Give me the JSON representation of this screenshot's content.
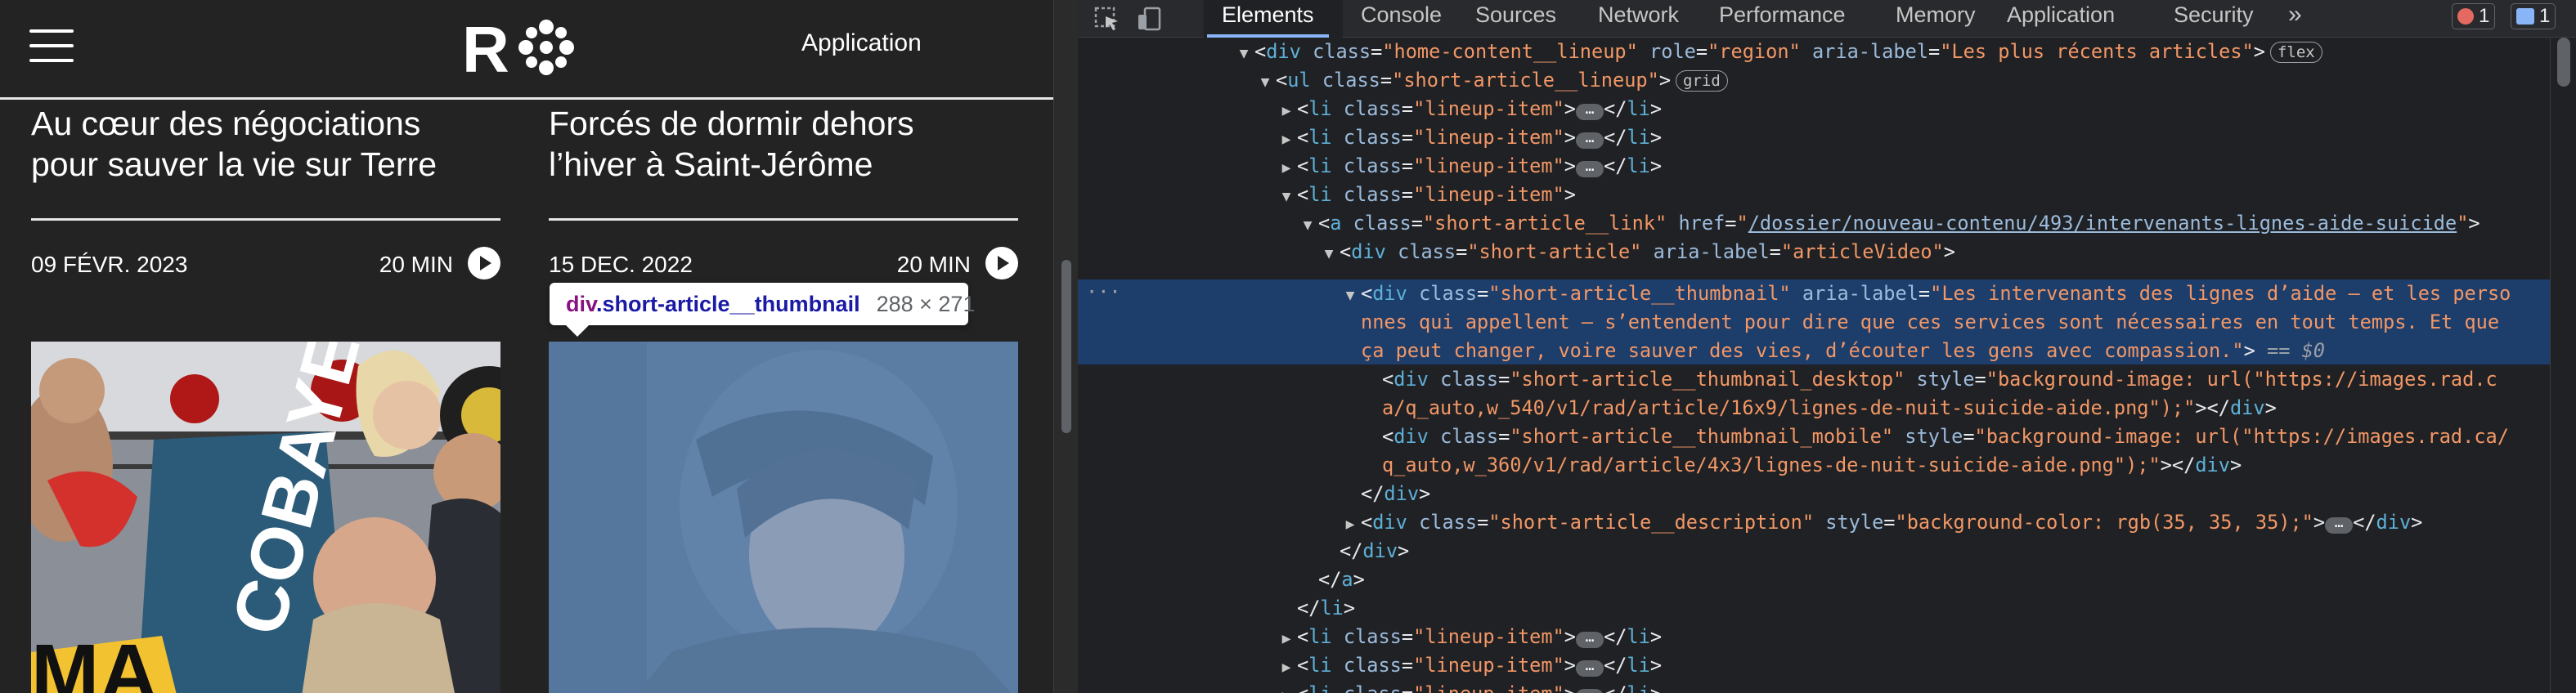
{
  "page": {
    "nav_link": "Application",
    "cards": [
      {
        "title": "Au cœur des négociations\npour sauver la vie sur Terre",
        "date": "09 FÉVR. 2023",
        "duration": "20 MIN"
      },
      {
        "title": "Forcés de dormir dehors\nl’hiver à Saint-Jérôme",
        "date": "15 DEC. 2022",
        "duration": "20 MIN"
      }
    ],
    "tooltip": {
      "tag": "div",
      "class": ".short-article__thumbnail",
      "size": "288 × 271"
    }
  },
  "devtools": {
    "tabs": [
      "Elements",
      "Console",
      "Sources",
      "Network",
      "Performance",
      "Memory",
      "Application",
      "Security"
    ],
    "more": "»",
    "error_count": "1",
    "message_count": "1",
    "tree": {
      "l0_tag": "div",
      "l0_attr1": "class",
      "l0_val1": "\"home-content__lineup\"",
      "l0_attr2": "role",
      "l0_val2": "\"region\"",
      "l0_attr3": "aria-label",
      "l0_val3": "\"Les plus récents articles\"",
      "l0_badge": "flex",
      "l1_tag": "ul",
      "l1_attr": "class",
      "l1_val": "\"short-article__lineup\"",
      "l1_badge": "grid",
      "li_tag": "li",
      "li_attr": "class",
      "li_val": "\"lineup-item\"",
      "a_tag": "a",
      "a_attr1": "class",
      "a_val1": "\"short-article__link\"",
      "a_attr2": "href",
      "a_href": "/dossier/nouveau-contenu/493/intervenants-lignes-aide-suicide",
      "sa_tag": "div",
      "sa_attr1": "class",
      "sa_val1": "\"short-article\"",
      "sa_attr2": "aria-label",
      "sa_val2": "\"articleVideo\"",
      "th_tag": "div",
      "th_attr1": "class",
      "th_val1": "\"short-article__thumbnail\"",
      "th_attr2": "aria-label",
      "th_label_1": "\"Les intervenants des lignes d’aide — et les perso",
      "th_label_2": "nnes qui appellent — s’entendent pour dire que ces services sont nécessaires en tout temps. Et que",
      "th_label_3": "ça peut changer, voire sauver des vies, d’écouter les gens avec compassion.\"",
      "th_eq": "== $0",
      "td_tag": "div",
      "td_attr1": "class",
      "td_val1": "\"short-article__thumbnail_desktop\"",
      "td_attr2": "style",
      "td_style_1": "\"background-image: url(\"https://images.rad.c",
      "td_style_2": "a/q_auto,w_540/v1/rad/article/16x9/lignes-de-nuit-suicide-aide.png\");\"",
      "tm_tag": "div",
      "tm_attr1": "class",
      "tm_val1": "\"short-article__thumbnail_mobile\"",
      "tm_attr2": "style",
      "tm_style_1": "\"background-image: url(\"https://images.rad.ca/",
      "tm_style_2": "q_auto,w_360/v1/rad/article/4x3/lignes-de-nuit-suicide-aide.png\");\"",
      "ds_tag": "div",
      "ds_attr1": "class",
      "ds_val1": "\"short-article__description\"",
      "ds_attr2": "style",
      "ds_val2": "\"background-color: rgb(35, 35, 35);\"",
      "close_div": "div",
      "close_a": "a",
      "close_li": "li",
      "ellipsis": "…",
      "gutter_dots": "···"
    }
  },
  "colors": {
    "tag": "#5db0d7",
    "attr": "#9bbbdc",
    "value": "#f29766",
    "selection": "#1d3d6b",
    "page_bg": "#232323"
  }
}
